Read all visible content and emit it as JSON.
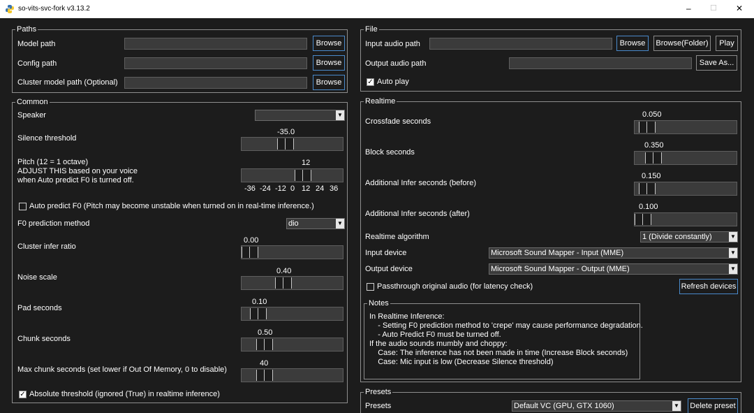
{
  "window": {
    "title": "so-vits-svc-fork v3.13.2",
    "min_glyph": "–",
    "max_glyph": "☐",
    "close_glyph": "✕"
  },
  "paths": {
    "title": "Paths",
    "model_label": "Model path",
    "config_label": "Config path",
    "cluster_label": "Cluster model path (Optional)",
    "browse_label": "Browse"
  },
  "common": {
    "title": "Common",
    "speaker_label": "Speaker",
    "silence_label": "Silence threshold",
    "silence_value": "-35.0",
    "silence_level": 0.42,
    "pitch_label": "Pitch (12 = 1 octave)\nADJUST THIS based on your voice\nwhen Auto predict F0 is turned off.",
    "pitch_value": "12",
    "pitch_level": 0.63,
    "pitch_ticks": [
      "-36",
      "-24",
      "-12",
      "0",
      "12",
      "24",
      "36"
    ],
    "auto_predict_label": "Auto predict F0 (Pitch may become unstable when turned on in real-time inference.)",
    "auto_predict_checked": false,
    "f0_method_label": "F0 prediction method",
    "f0_method_value": "dio",
    "cluster_ratio_label": "Cluster infer ratio",
    "cluster_ratio_value": "0.00",
    "cluster_ratio_level": 0.0,
    "noise_label": "Noise scale",
    "noise_value": "0.40",
    "noise_level": 0.4,
    "pad_label": "Pad seconds",
    "pad_value": "0.10",
    "pad_level": 0.1,
    "chunk_label": "Chunk seconds",
    "chunk_value": "0.50",
    "chunk_level": 0.17,
    "max_chunk_label": "Max chunk seconds (set lower if Out Of Memory, 0 to disable)",
    "max_chunk_value": "40",
    "max_chunk_level": 0.17,
    "absolute_label": "Absolute threshold (ignored (True) in realtime inference)",
    "absolute_checked": true
  },
  "file": {
    "title": "File",
    "input_label": "Input audio path",
    "output_label": "Output audio path",
    "browse_label": "Browse",
    "browse_folder_label": "Browse(Folder)",
    "play_label": "Play",
    "save_as_label": "Save As...",
    "autoplay_label": "Auto play",
    "autoplay_checked": true
  },
  "realtime": {
    "title": "Realtime",
    "crossfade_label": "Crossfade seconds",
    "crossfade_value": "0.050",
    "crossfade_level": 0.05,
    "block_label": "Block seconds",
    "block_value": "0.350",
    "block_level": 0.12,
    "infer_before_label": "Additional Infer seconds (before)",
    "infer_before_value": "0.150",
    "infer_before_level": 0.05,
    "infer_after_label": "Additional Infer seconds (after)",
    "infer_after_value": "0.100",
    "infer_after_level": 0.0,
    "algorithm_label": "Realtime algorithm",
    "algorithm_value": "1 (Divide constantly)",
    "input_device_label": "Input device",
    "input_device_value": "Microsoft Sound Mapper - Input (MME)",
    "output_device_label": "Output device",
    "output_device_value": "Microsoft Sound Mapper - Output (MME)",
    "passthrough_label": "Passthrough original audio (for latency check)",
    "passthrough_checked": false,
    "refresh_label": "Refresh devices"
  },
  "notes": {
    "title": "Notes",
    "lines": [
      "In Realtime Inference:",
      "    - Setting F0 prediction method to 'crepe' may cause performance degradation.",
      "    - Auto Predict F0 must be turned off.",
      "If the audio sounds mumbly and choppy:",
      "    Case: The inference has not been made in time (Increase Block seconds)",
      "    Case: Mic input is low (Decrease Silence threshold)"
    ]
  },
  "presets": {
    "title": "Presets",
    "label": "Presets",
    "value": "Default VC (GPU, GTX 1060)",
    "delete_label": "Delete preset"
  },
  "colors": {
    "background": "#1c1c1c",
    "field": "#3b3b3b",
    "accent_border": "#4a8acb"
  }
}
